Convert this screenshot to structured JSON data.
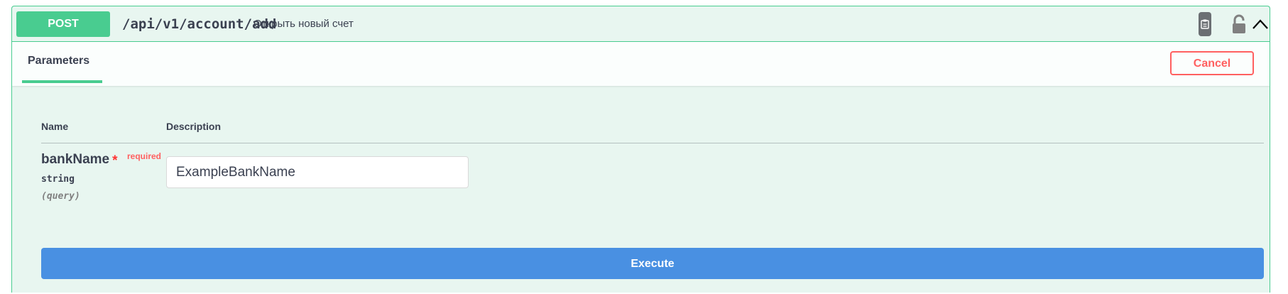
{
  "summary": {
    "method": "POST",
    "path": "/api/v1/account/add",
    "description": "Открыть новый счет",
    "icons": [
      "copy-to-clipboard-icon",
      "lock-icon",
      "chevron-up-icon"
    ]
  },
  "tabs": {
    "parameters_label": "Parameters"
  },
  "actions": {
    "cancel_label": "Cancel",
    "execute_label": "Execute"
  },
  "table": {
    "headers": {
      "name": "Name",
      "description": "Description"
    },
    "params": [
      {
        "name": "bankName",
        "required_star": "*",
        "required_label": "required",
        "type": "string",
        "in": "(query)",
        "value": "ExampleBankName"
      }
    ]
  },
  "colors": {
    "post_green": "#49cc90",
    "panel_bg": "#e8f6f0",
    "cancel_red": "#ff6060",
    "execute_blue": "#4990e2",
    "text": "#3b4151"
  }
}
